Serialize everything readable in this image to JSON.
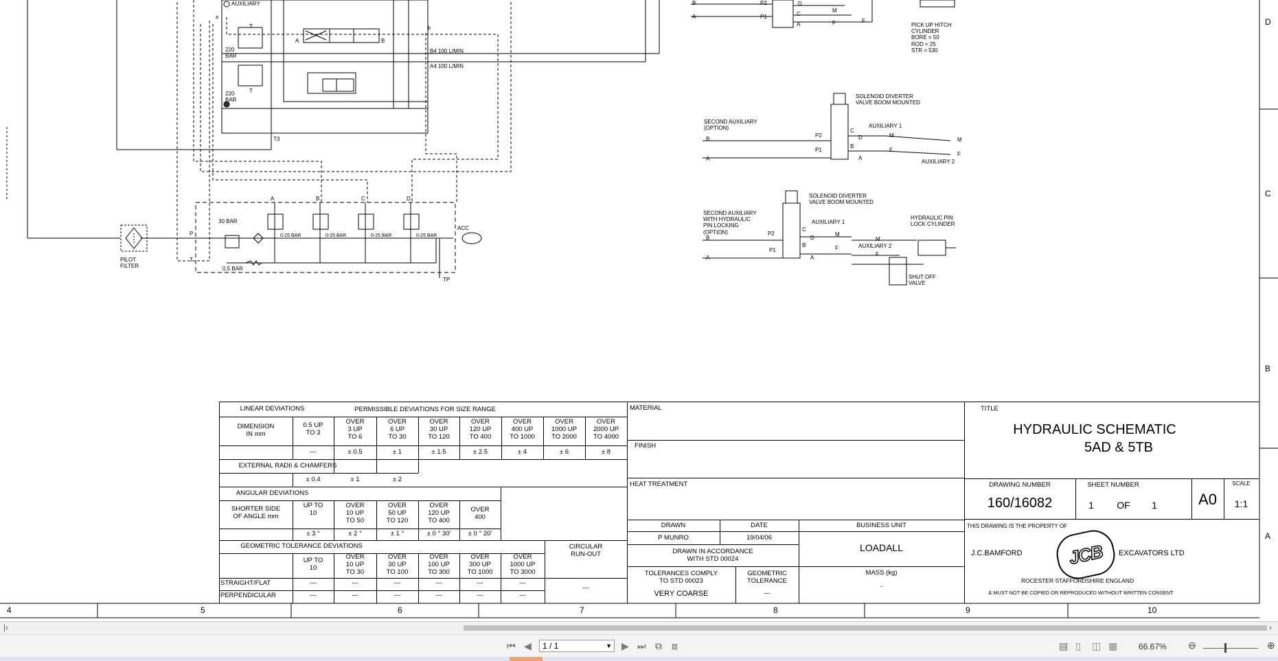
{
  "schematic": {
    "labels": {
      "auxiliary": "AUXILIARY",
      "bar220a": "220\nBAR",
      "bar220b": "220\nBAR",
      "b4": "B4 100 L/MIN",
      "a4": "A4 100 L/MIN",
      "t3": "T3",
      "pilot_filter": "PILOT\nFILTER",
      "bar30": "30 BAR",
      "bar05": "0.5 BAR",
      "p": "P",
      "t": "T",
      "acc": "ACC",
      "tp": "TP",
      "sec_a": "A",
      "sec_b": "B",
      "sec_c": "C",
      "sec_d": "D",
      "bar025_1": "0-25 BAR",
      "bar025_2": "0-25 BAR",
      "bar025_3": "0-25 BAR",
      "bar025_4": "0-25 BAR",
      "a_left": "A",
      "b_left": "B",
      "b_small": "b",
      "a_small": "a",
      "t_label": "T",
      "t_label2": "T",
      "pick_up_hitch": "PICK UP HITCH\nCYLINDER\nBORE = 50\nROD = 25\nSTR = 530",
      "top_p2": "P2",
      "top_p1": "P1",
      "top_b": "B",
      "top_a": "A",
      "top_d": "D",
      "top_m": "M",
      "top_f": "F",
      "top_f2": "F",
      "top_c": "C",
      "top_a2": "A",
      "diverter1_title": "SOLENOID DIVERTER\nVALVE BOOM MOUNTED",
      "second_aux": "SECOND AUXILIARY\n(OPTION)",
      "aux1_a": "AUXILIARY 1",
      "aux2_a": "AUXILIARY 2",
      "d1_p2": "P2",
      "d1_p1": "P1",
      "d1_b": "B",
      "d1_a": "A",
      "d1_c": "C",
      "d1_d": "D",
      "d1_b2": "B",
      "d1_a2": "A",
      "d1_m": "M",
      "d1_f": "F",
      "d1_m2": "M",
      "d1_f2": "F",
      "diverter2_title": "SOLENOID DIVERTER\nVALVE BOOM MOUNTED",
      "second_aux_pin": "SECOND AUXILIARY\nWITH HYDRAULIC\nPIN LOCKING\n(OPTION)",
      "aux1_b": "AUXILIARY 1",
      "aux2_b": "AUXILIARY 2",
      "pin_lock": "HYDRAULIC PIN\nLOCK CYLINDER",
      "shut_off": "SHUT OFF\nVALVE",
      "d2_p2": "P2",
      "d2_p1": "P1",
      "d2_b": "B",
      "d2_a": "A",
      "d2_c": "C",
      "d2_d": "D",
      "d2_b2": "B",
      "d2_a2": "A",
      "d2_m": "M",
      "d2_f": "F",
      "d2_m2": "M",
      "d2_f2": "F"
    },
    "zone_letters_right": [
      "D",
      "C",
      "B",
      "A"
    ],
    "zone_numbers_bottom": [
      "4",
      "5",
      "6",
      "7",
      "8",
      "9",
      "10"
    ]
  },
  "title_block": {
    "linear_deviations": "LINEAR DEVIATIONS",
    "permissible": "PERMISSIBLE DEVIATIONS FOR SIZE RANGE",
    "dimension": "DIMENSION\nIN mm",
    "size_ranges": [
      "0.5 UP\nTO 3",
      "OVER\n3 UP\nTO 6",
      "OVER\n6 UP\nTO 30",
      "OVER\n30 UP\nTO 120",
      "OVER\n120 UP\nTO 400",
      "OVER\n400 UP\nTO 1000",
      "OVER\n1000 UP\nTO 2000",
      "OVER\n2000 UP\nTO 4000"
    ],
    "linear_values": [
      "---",
      "± 0.5",
      "± 1",
      "± 1.5",
      "± 2.5",
      "± 4",
      "± 6",
      "± 8"
    ],
    "external_radii": "EXTERNAL RADII & CHAMFERS",
    "radii_values": [
      "± 0.4",
      "± 1",
      "± 2"
    ],
    "angular_deviations": "ANGULAR DEVIATIONS",
    "shorter_side": "SHORTER SIDE\nOF ANGLE mm",
    "angle_ranges": [
      "UP TO\n10",
      "OVER\n10 UP\nTO 50",
      "OVER\n50 UP\nTO 120",
      "OVER\n120 UP\nTO 400",
      "OVER\n400"
    ],
    "angle_values": [
      "± 3 °",
      "± 2 °",
      "± 1 °",
      "± 0 ° 30'",
      "± 0 ° 20'"
    ],
    "geometric_tolerance": "GEOMETRIC TOLERANCE DEVIATIONS",
    "circular_runout": "CIRCULAR\nRUN-OUT",
    "geo_ranges": [
      "UP TO\n10",
      "OVER\n10 UP\nTO 30",
      "OVER\n30 UP\nTO 100",
      "OVER\n100 UP\nTO 300",
      "OVER\n300 UP\nTO 1000",
      "OVER\n1000 UP\nTO 3000"
    ],
    "straight_flat": "STRAIGHT/FLAT",
    "perpendicular": "PERPENDICULAR",
    "geo_values_straight": [
      "---",
      "---",
      "---",
      "---",
      "---",
      "---"
    ],
    "geo_values_perp": [
      "---",
      "---",
      "---",
      "---",
      "---",
      "---"
    ],
    "runout_value": "---",
    "material": "MATERIAL",
    "finish": "FINISH",
    "heat_treatment": "HEAT TREATMENT",
    "drawn": "DRAWN",
    "date": "DATE",
    "drawn_by": "P MUNRO",
    "date_value": "19/04/06",
    "drawn_accordance": "DRAWN IN ACCORDANCE\nWITH STD 00024",
    "tolerances_comply": "TOLERANCES COMPLY\nTO STD 00023",
    "very_coarse": "VERY COARSE",
    "geometric_tol": "GEOMETRIC\nTOLERANCE",
    "geometric_tol_value": "---",
    "business_unit": "BUSINESS UNIT",
    "business_unit_value": "LOADALL",
    "mass": "MASS (kg)",
    "mass_value": "-",
    "title_label": "TITLE",
    "title_line1": "HYDRAULIC SCHEMATIC",
    "title_line2": "5AD & 5TB",
    "drawing_number_label": "DRAWING NUMBER",
    "drawing_number": "160/16082",
    "sheet_number_label": "SHEET NUMBER",
    "sheet_1": "1",
    "sheet_of": "OF",
    "sheet_total": "1",
    "size": "A0",
    "scale_label": "SCALE",
    "scale_value": "1:1",
    "property_of": "THIS DRAWING IS THE PROPERTY OF",
    "jc_bamford": "J.C.BAMFORD",
    "excavators": "EXCAVATORS LTD",
    "logo_text": "JCB",
    "address": "ROCESTER    STAFFORDSHIRE    ENGLAND",
    "must_not": "& MUST NOT BE COPIED OR REPRODUCED WITHOUT WRITTEN CONSENT"
  },
  "viewer": {
    "page_indicator": "1 / 1",
    "zoom": "66.67%",
    "icons": [
      "first-page-icon",
      "prev-page-icon",
      "next-page-icon",
      "last-page-icon",
      "fit-page-icon",
      "fit-width-icon",
      "single-page-icon",
      "continuous-icon",
      "facing-icon",
      "facing-continuous-icon",
      "zoom-out-icon",
      "zoom-in-icon"
    ]
  }
}
